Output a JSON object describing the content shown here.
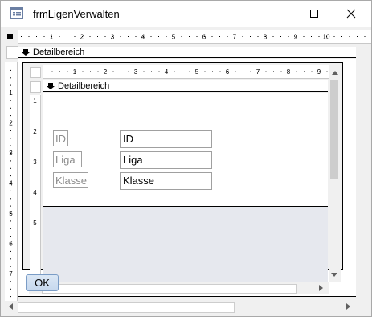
{
  "window": {
    "title": "frmLigenVerwalten",
    "icon": "form-icon",
    "controls": [
      "minimize-icon",
      "maximize-icon",
      "close-icon"
    ]
  },
  "outer": {
    "section_label": "Detailbereich",
    "ruler_numbers": [
      "1",
      "2",
      "3",
      "4",
      "5",
      "6",
      "7",
      "8",
      "9",
      "10"
    ],
    "vruler_numbers": [
      "1",
      "2",
      "3",
      "4",
      "5",
      "6",
      "7"
    ]
  },
  "subform": {
    "section_label": "Detailbereich",
    "ruler_numbers": [
      "1",
      "2",
      "3",
      "4",
      "5",
      "6",
      "7",
      "8",
      "9"
    ],
    "vruler_numbers": [
      "1",
      "2",
      "3",
      "4",
      "5"
    ],
    "fields": [
      {
        "label": "ID",
        "value": "ID"
      },
      {
        "label": "Liga",
        "value": "Liga"
      },
      {
        "label": "Klasse",
        "value": "Klasse"
      }
    ]
  },
  "buttons": {
    "ok": "OK"
  },
  "colors": {
    "detail_background": "#e6e8ee",
    "chrome": "#f0f0f0",
    "ok_border": "#7a9cc6"
  }
}
